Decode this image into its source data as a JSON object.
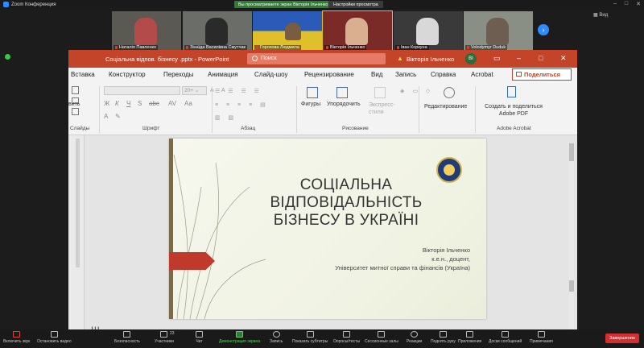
{
  "zoom": {
    "app_title": "Zoom Конференция",
    "share_banner": "Вы просматриваете экран Вікторія Ільченко",
    "view_options": "Настройки просмотра",
    "view_label": "Вид",
    "participants": [
      {
        "name": "Наталія Павленко"
      },
      {
        "name": "Зінаїда Василівна Смутчак"
      },
      {
        "name": "Горохова Людмила"
      },
      {
        "name": "Вікторія Ільченко"
      },
      {
        "name": "Іван Коркуна"
      },
      {
        "name": "Volodymyr Duduk"
      }
    ],
    "toolbar": [
      {
        "label": "Включить звук",
        "icon": "mic-muted-icon"
      },
      {
        "label": "Остановить видео",
        "icon": "video-icon"
      },
      {
        "label": "Безопасность",
        "icon": "shield-icon"
      },
      {
        "label": "Участники",
        "icon": "participants-icon",
        "count": "23"
      },
      {
        "label": "Чат",
        "icon": "chat-icon"
      },
      {
        "label": "Демонстрация экрана",
        "icon": "share-screen-icon"
      },
      {
        "label": "Запись",
        "icon": "record-icon"
      },
      {
        "label": "Показать субтитры",
        "icon": "cc-icon"
      },
      {
        "label": "Опросы/тесты",
        "icon": "poll-icon"
      },
      {
        "label": "Сессионные залы",
        "icon": "breakout-icon"
      },
      {
        "label": "Реакции",
        "icon": "reaction-icon"
      },
      {
        "label": "Поднять руку",
        "icon": "hand-icon"
      },
      {
        "label": "Приложения",
        "icon": "apps-icon"
      },
      {
        "label": "Доски сообщений",
        "icon": "whiteboard-icon"
      },
      {
        "label": "Примечания",
        "icon": "notes-icon"
      }
    ],
    "end_label": "Завершение"
  },
  "ppt": {
    "window_title": "Соціальна відпов. бізнесу .pptx - PowerPoint",
    "search_placeholder": "Поиск",
    "user_name": "Вікторія Ільченко",
    "user_initials": "ВІ",
    "tabs": [
      "Вставка",
      "Конструктор",
      "Переходы",
      "Анимация",
      "Слайд-шоу",
      "Рецензирование",
      "Вид",
      "Запись",
      "Справка",
      "Acrobat"
    ],
    "share_label": "Поделиться",
    "ribbon": {
      "paste_label": "вить",
      "slides_group": "Слайды",
      "font_group": "Шрифт",
      "font_size": "20+",
      "paragraph_group": "Абзац",
      "shapes_label": "Фигуры",
      "arrange_label": "Упорядочить",
      "express_styles_label": "Экспресс-стили",
      "drawing_group": "Рисование",
      "editing_label": "Редактирование",
      "acrobat_create_label": "Создать и поделиться Adobe PDF",
      "acrobat_group": "Adobe Acrobat"
    },
    "slide": {
      "title_lines": [
        "СОЦІАЛЬНА",
        "ВІДПОВІДАЛЬНІСТЬ",
        "БІЗНЕСУ В УКРАЇНІ"
      ],
      "author_lines": [
        "Вікторія Ільченко",
        "к.е.н., доцент,",
        "Університет митної справи та фінансів (Україна)"
      ]
    },
    "notes_peek": "Щ"
  }
}
